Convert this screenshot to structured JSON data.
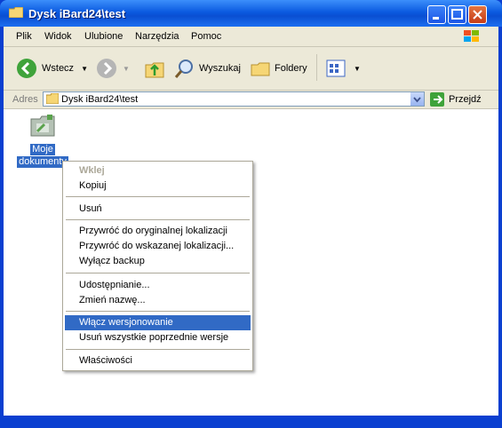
{
  "window": {
    "title": "Dysk iBard24\\test"
  },
  "menu": [
    "Plik",
    "Widok",
    "Ulubione",
    "Narzędzia",
    "Pomoc"
  ],
  "toolbar": {
    "back": "Wstecz",
    "search": "Wyszukaj",
    "folders": "Foldery"
  },
  "address": {
    "label": "Adres",
    "value": "Dysk iBard24\\test",
    "go": "Przejdź"
  },
  "item": {
    "label_line1": "Moje",
    "label_line2": "dokumenty"
  },
  "context_menu": {
    "paste": "Wklej",
    "copy": "Kopiuj",
    "delete": "Usuń",
    "restore_original": "Przywróć do oryginalnej lokalizacji",
    "restore_chosen": "Przywróć do wskazanej lokalizacji...",
    "disable_backup": "Wyłącz backup",
    "share": "Udostępnianie...",
    "rename": "Zmień nazwę...",
    "enable_versioning": "Włącz wersjonowanie",
    "delete_versions": "Usuń wszystkie poprzednie wersje",
    "properties": "Właściwości"
  }
}
